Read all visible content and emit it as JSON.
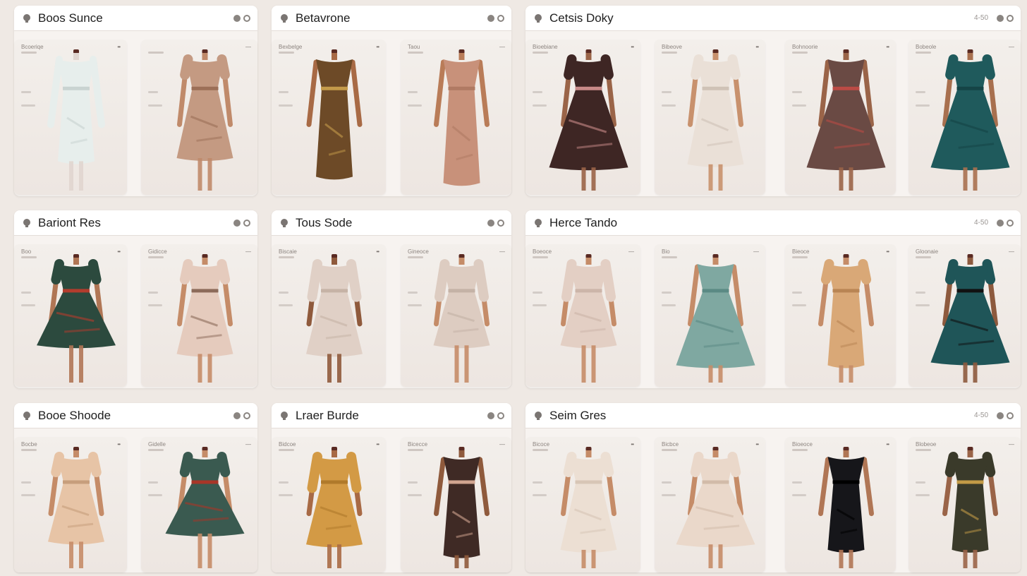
{
  "colors": {
    "background": "#efe9e4",
    "panel": "#f7f3f0",
    "header": "#ffffff"
  },
  "panels": [
    {
      "title": "Boos Sunce",
      "meta": "",
      "cards": [
        {
          "label": "Bcoeriqe",
          "dots": "••",
          "dress": "white-coat"
        },
        {
          "label": "",
          "dots": "—",
          "dress": "tan-shirtdress"
        }
      ]
    },
    {
      "title": "Betavrone",
      "meta": "",
      "cards": [
        {
          "label": "Bexbelge",
          "dots": "••",
          "dress": "gold-print-slip"
        },
        {
          "label": "Taou",
          "dots": "—",
          "dress": "rose-slip"
        }
      ]
    },
    {
      "title": "Cetsis Doky",
      "meta": "4-50",
      "cards": [
        {
          "label": "Bioebiane",
          "dots": "••",
          "dress": "floral-swing"
        },
        {
          "label": "Bibeove",
          "dots": "••",
          "dress": "cream-belted"
        },
        {
          "label": "Bohnoorie",
          "dots": "••",
          "dress": "floral-tulle"
        },
        {
          "label": "Bobeole",
          "dots": "—",
          "dress": "teal-swing"
        }
      ]
    },
    {
      "title": "Bariont Res",
      "meta": "",
      "cards": [
        {
          "label": "Boo",
          "dots": "••",
          "dress": "print-wrap-swing"
        },
        {
          "label": "Gidicce",
          "dots": "—",
          "dress": "blush-belted"
        }
      ]
    },
    {
      "title": "Tous Sode",
      "meta": "",
      "cards": [
        {
          "label": "Biscaie",
          "dots": "••",
          "dress": "beige-tiered"
        },
        {
          "label": "Gineoce",
          "dots": "—",
          "dress": "beige-sleeve"
        }
      ]
    },
    {
      "title": "Herce Tando",
      "meta": "4-50",
      "cards": [
        {
          "label": "Boeoce",
          "dots": "—",
          "dress": "blush-sleeve"
        },
        {
          "label": "Bio",
          "dots": "—",
          "dress": "aqua-lace"
        },
        {
          "label": "Bieoce",
          "dots": "••",
          "dress": "caramel-wrap"
        },
        {
          "label": "Gloonaie",
          "dots": "—",
          "dress": "teal-belted"
        }
      ]
    },
    {
      "title": "Booe Shoode",
      "meta": "",
      "cards": [
        {
          "label": "Bocbe",
          "dots": "••",
          "dress": "peach-midi"
        },
        {
          "label": "Gidelle",
          "dots": "—",
          "dress": "print-belted"
        }
      ]
    },
    {
      "title": "Lraer Burde",
      "meta": "",
      "cards": [
        {
          "label": "Bidcoe",
          "dots": "••",
          "dress": "mustard-wrap"
        },
        {
          "label": "Bicecce",
          "dots": "—",
          "dress": "floral-slip"
        }
      ]
    },
    {
      "title": "Seim Gres",
      "meta": "4-50",
      "cards": [
        {
          "label": "Bicoce",
          "dots": "••",
          "dress": "cream-asym"
        },
        {
          "label": "Bicbce",
          "dots": "••",
          "dress": "blush-swing"
        },
        {
          "label": "Bioeoce",
          "dots": "••",
          "dress": "black-sheath"
        },
        {
          "label": "Blobeoe",
          "dots": "—",
          "dress": "print-sheath"
        }
      ]
    }
  ],
  "icons": {
    "header": "hanger-icon",
    "actions": [
      "home-icon",
      "settings-icon"
    ]
  }
}
